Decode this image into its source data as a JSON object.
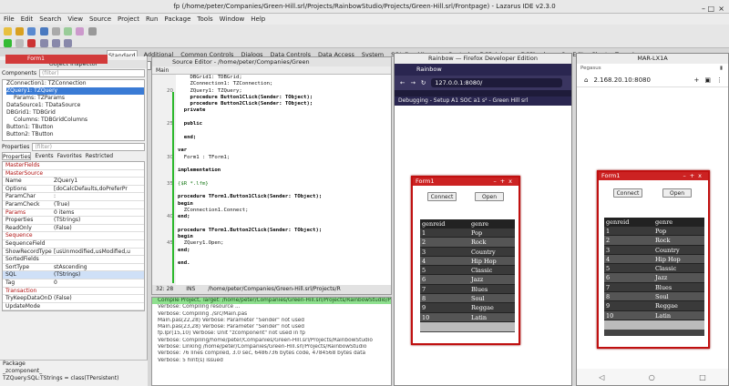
{
  "window": {
    "title": "fp (/home/peter/Companies/Green-Hill.srl/Projects/RainbowStudio/Projects/Green-Hill.srl/Frontpage) - Lazarus IDE v2.3.0"
  },
  "menu": [
    "File",
    "Edit",
    "Search",
    "View",
    "Source",
    "Project",
    "Run",
    "Package",
    "Tools",
    "Window",
    "Help"
  ],
  "component_tabs": [
    "Standard",
    "Additional",
    "Common Controls",
    "Dialogs",
    "Data Controls",
    "Data Access",
    "System",
    "SQLdb",
    "Misc",
    "LazControls",
    "DCPciphers",
    "DCPhashes",
    "SynEdit",
    "Chart",
    "Zeos Access"
  ],
  "form1_mini": "Form1",
  "inspector": {
    "title": "Object Inspector",
    "components_label": "Components",
    "filter_placeholder": "(filter)",
    "tree": [
      {
        "label": "ZConnection1: TZConnection",
        "sel": false
      },
      {
        "label": "ZQuery1: TZQuery",
        "sel": true
      },
      {
        "label": "Params: TZParams",
        "sel": false
      },
      {
        "label": "DataSource1: TDataSource",
        "sel": false
      },
      {
        "label": "DBGrid1: TDBGrid",
        "sel": false
      },
      {
        "label": "Columns: TDBGridColumns",
        "sel": false
      },
      {
        "label": "Button1: TButton",
        "sel": false
      },
      {
        "label": "Button2: TButton",
        "sel": false
      }
    ],
    "properties_label": "Properties",
    "tabs": [
      "Properties",
      "Events",
      "Favorites",
      "Restricted"
    ],
    "props": [
      {
        "n": "MasterFields",
        "v": "",
        "red": true,
        "hl": false
      },
      {
        "n": "MasterSource",
        "v": "",
        "red": true,
        "hl": false
      },
      {
        "n": "Name",
        "v": "ZQuery1",
        "red": false,
        "hl": false
      },
      {
        "n": "Options",
        "v": "[doCalcDefaults,doPreferPr",
        "red": false,
        "hl": false
      },
      {
        "n": "ParamChar",
        "v": ":",
        "red": false,
        "hl": false
      },
      {
        "n": "ParamCheck",
        "v": "(True)",
        "red": false,
        "hl": false
      },
      {
        "n": "Params",
        "v": "0 items",
        "red": true,
        "hl": false
      },
      {
        "n": "Properties",
        "v": "(TStrings)",
        "red": false,
        "hl": false
      },
      {
        "n": "ReadOnly",
        "v": "(False)",
        "red": false,
        "hl": false
      },
      {
        "n": "Sequence",
        "v": "",
        "red": true,
        "hl": false
      },
      {
        "n": "SequenceField",
        "v": "",
        "red": false,
        "hl": false
      },
      {
        "n": "ShowRecordTypes",
        "v": "[usUnmodified,usModified,u",
        "red": false,
        "hl": false
      },
      {
        "n": "SortedFields",
        "v": "",
        "red": false,
        "hl": false
      },
      {
        "n": "SortType",
        "v": "stAscending",
        "red": false,
        "hl": false
      },
      {
        "n": "SQL",
        "v": "(TStrings)",
        "red": false,
        "hl": true
      },
      {
        "n": "Tag",
        "v": "0",
        "red": false,
        "hl": false
      },
      {
        "n": "Transaction",
        "v": "",
        "red": true,
        "hl": false
      },
      {
        "n": "TryKeepDataOnDis",
        "v": "(False)",
        "red": false,
        "hl": false
      },
      {
        "n": "UpdateMode",
        "v": "",
        "red": false,
        "hl": false
      }
    ],
    "bottom": [
      "Package",
      "_zcomponent_",
      "TZQuery.SQL:TStrings = class(TPersistent)"
    ]
  },
  "editor": {
    "title": "Source Editor - /home/peter/Companies/Green",
    "tab": "Main",
    "gutter": [
      "",
      "",
      "20",
      "",
      "",
      "",
      "",
      "25",
      "",
      "",
      "",
      "",
      "30",
      "",
      "",
      "",
      "35",
      "",
      "",
      "",
      "",
      "40",
      "",
      "",
      "",
      "45",
      "",
      "",
      "",
      "",
      "",
      ""
    ],
    "lines": [
      "    DBGrid1: TDBGrid;",
      "    ZConnection1: TZConnection;",
      "    ZQuery1: TZQuery;",
      "    procedure Button1Click(Sender: TObject);",
      "    procedure Button2Click(Sender: TObject);",
      "  private",
      "",
      "  public",
      "",
      "  end;",
      "",
      "var",
      "  Form1 : TForm1;",
      "",
      "implementation",
      "",
      "{$R *.lfm}",
      "",
      "procedure TForm1.Button1Click(Sender: TObject);",
      "begin",
      "  ZConnection1.Connect;",
      "end;",
      "",
      "procedure TForm1.Button2Click(Sender: TObject);",
      "begin",
      "  ZQuery1.Open;",
      "end;",
      "",
      "end."
    ],
    "status_pos": "32: 28",
    "status_mode": "INS",
    "status_path": "/home/peter/Companies/Green-Hill.srl/Projects/R"
  },
  "messages": [
    "Compile Project, Target: /home/peter/Companies/Green-Hill.srl/Projects/RainbowStudio/P",
    "Verbose: Compiling resource ...",
    "Verbose: Compiling ./src/Main.pas",
    "Main.pas(22,28) Verbose: Parameter \"Sender\" not used",
    "Main.pas(23,28) Verbose: Parameter \"Sender\" not used",
    "fp.lpr(15,10) Verbose: Unit \"zcomponent\" not used in fp",
    "Verbose: Compiling/home/peter/Companies/Green-Hill.srl/Projects/RainbowStudio",
    "Verbose: Linking /home/peter/Companies/Green-Hill.srl/Projects/RainbowStudio",
    "Verbose: 76 lines compiled, 3.0 sec, 6486736 bytes code, 4784568 bytes data",
    "Verbose: 5 hint(s) issued"
  ],
  "firefox": {
    "title": "Rainbow — Firefox Developer Edition",
    "tab": "Rainbow",
    "url": "127.0.0.1:8080/",
    "bookmarks": "Debugging - Setup   A1 SOC a1   s² - Green Hill srl"
  },
  "phone": {
    "title": "MAR-LX1A",
    "status": "Pegasus",
    "url": "2.168.20.10:8080"
  },
  "webapp": {
    "form_title": "Form1",
    "connect": "Connect",
    "open": "Open",
    "col_id": "genreid",
    "col_genre": "genre",
    "rows": [
      {
        "id": "1",
        "g": "Pop"
      },
      {
        "id": "2",
        "g": "Rock"
      },
      {
        "id": "3",
        "g": "Country"
      },
      {
        "id": "4",
        "g": "Hip Hop"
      },
      {
        "id": "5",
        "g": "Classic"
      },
      {
        "id": "6",
        "g": "Jazz"
      },
      {
        "id": "7",
        "g": "Blues"
      },
      {
        "id": "8",
        "g": "Soul"
      },
      {
        "id": "9",
        "g": "Reggae"
      },
      {
        "id": "10",
        "g": "Latin"
      }
    ]
  },
  "colors": {
    "accent_red": "#c22222",
    "selection": "#3a7bd5",
    "messages_green": "#8fe08f"
  }
}
